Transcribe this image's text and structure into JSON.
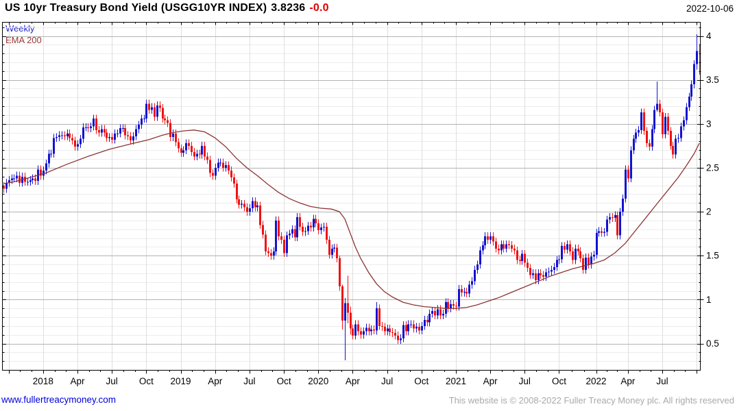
{
  "header": {
    "title": "US 10yr Treasury Bond Yield (USGG10YR INDEX)",
    "last_value": "3.8236",
    "change": "-0.0",
    "date": "2022-10-06"
  },
  "legend": {
    "series_label": "Weekly",
    "overlay_label": "EMA 200"
  },
  "footer": {
    "website": "www.fullertreacymoney.com",
    "copyright": "This website is © 2008-2022 Fuller Treacy Money plc. All rights reserved"
  },
  "colors": {
    "up_candle": "#1212d0",
    "down_candle": "#ee1212",
    "ema_line": "#8b3333",
    "grid_minor": "#ececec",
    "grid_major": "#b3b3b3",
    "grid_vertical": "#dedede",
    "axis": "#000000",
    "label": "#000000"
  },
  "chart_data": {
    "type": "candlestick",
    "frequency": "weekly",
    "title": "US 10yr Treasury Bond Yield (USGG10YR INDEX)",
    "symbol": "USGG10YR INDEX",
    "last": 3.8236,
    "change": -0.0,
    "as_of": "2022-10-06",
    "start_week": "2017-09-22",
    "end_week": "2022-10-06",
    "overlay": "EMA 200",
    "y_axis": {
      "min": 0.2,
      "max": 4.16,
      "minor_step": 0.1,
      "ticks": [
        0.5,
        1,
        1.5,
        2,
        2.5,
        3,
        3.5,
        4
      ]
    },
    "x_labels": [
      {
        "week": 2,
        "label": ""
      },
      {
        "week": 15,
        "label": "2018"
      },
      {
        "week": 28,
        "label": "Apr"
      },
      {
        "week": 41,
        "label": "Jul"
      },
      {
        "week": 54,
        "label": "Oct"
      },
      {
        "week": 67,
        "label": "2019"
      },
      {
        "week": 80,
        "label": "Apr"
      },
      {
        "week": 93,
        "label": "Jul"
      },
      {
        "week": 106,
        "label": "Oct"
      },
      {
        "week": 119,
        "label": "2020"
      },
      {
        "week": 132,
        "label": "Apr"
      },
      {
        "week": 145,
        "label": "Jul"
      },
      {
        "week": 158,
        "label": "Oct"
      },
      {
        "week": 171,
        "label": "2021"
      },
      {
        "week": 184,
        "label": "Apr"
      },
      {
        "week": 197,
        "label": "Jul"
      },
      {
        "week": 210,
        "label": "Oct"
      },
      {
        "week": 224,
        "label": "2022"
      },
      {
        "week": 236,
        "label": "Apr"
      },
      {
        "week": 249,
        "label": "Jul"
      },
      {
        "week": 262,
        "label": ""
      }
    ],
    "first_open": 2.29,
    "closes": [
      2.26,
      2.33,
      2.36,
      2.38,
      2.38,
      2.41,
      2.33,
      2.4,
      2.34,
      2.34,
      2.36,
      2.38,
      2.35,
      2.48,
      2.41,
      2.47,
      2.55,
      2.66,
      2.66,
      2.84,
      2.85,
      2.87,
      2.87,
      2.86,
      2.89,
      2.84,
      2.81,
      2.74,
      2.77,
      2.83,
      2.96,
      2.96,
      2.95,
      2.97,
      3.06,
      2.93,
      2.9,
      2.94,
      2.9,
      2.84,
      2.85,
      2.82,
      2.89,
      2.89,
      2.95,
      2.95,
      2.87,
      2.86,
      2.81,
      2.86,
      2.94,
      2.99,
      3.06,
      3.06,
      3.23,
      3.16,
      3.19,
      3.08,
      3.21,
      3.18,
      3.06,
      3.04,
      3.01,
      2.85,
      2.89,
      2.79,
      2.72,
      2.67,
      2.7,
      2.78,
      2.75,
      2.68,
      2.63,
      2.66,
      2.65,
      2.75,
      2.63,
      2.59,
      2.44,
      2.41,
      2.5,
      2.56,
      2.56,
      2.5,
      2.53,
      2.47,
      2.39,
      2.32,
      2.14,
      2.08,
      2.09,
      2.05,
      2.0,
      2.04,
      2.12,
      2.05,
      2.07,
      1.85,
      1.74,
      1.55,
      1.53,
      1.5,
      1.55,
      1.9,
      1.72,
      1.68,
      1.53,
      1.73,
      1.75,
      1.8,
      1.71,
      1.94,
      1.83,
      1.77,
      1.78,
      1.84,
      1.82,
      1.92,
      1.87,
      1.79,
      1.82,
      1.83,
      1.68,
      1.51,
      1.58,
      1.59,
      1.47,
      1.15,
      0.76,
      0.96,
      0.85,
      0.67,
      0.59,
      0.72,
      0.64,
      0.6,
      0.64,
      0.68,
      0.64,
      0.66,
      0.65,
      0.9,
      0.7,
      0.69,
      0.64,
      0.67,
      0.63,
      0.62,
      0.59,
      0.54,
      0.56,
      0.71,
      0.64,
      0.72,
      0.72,
      0.67,
      0.69,
      0.65,
      0.7,
      0.77,
      0.74,
      0.84,
      0.87,
      0.82,
      0.89,
      0.82,
      0.84,
      0.97,
      0.9,
      0.95,
      0.93,
      0.92,
      1.12,
      1.08,
      1.09,
      1.07,
      1.17,
      1.21,
      1.34,
      1.4,
      1.56,
      1.62,
      1.72,
      1.68,
      1.72,
      1.66,
      1.58,
      1.56,
      1.63,
      1.58,
      1.63,
      1.62,
      1.58,
      1.56,
      1.45,
      1.44,
      1.52,
      1.42,
      1.36,
      1.28,
      1.3,
      1.22,
      1.3,
      1.28,
      1.26,
      1.31,
      1.32,
      1.34,
      1.37,
      1.45,
      1.46,
      1.61,
      1.57,
      1.63,
      1.55,
      1.45,
      1.58,
      1.55,
      1.47,
      1.34,
      1.48,
      1.4,
      1.49,
      1.51,
      1.76,
      1.78,
      1.76,
      1.77,
      1.91,
      1.94,
      1.93,
      1.96,
      1.73,
      2.0,
      2.15,
      2.48,
      2.38,
      2.7,
      2.83,
      2.9,
      2.93,
      3.13,
      2.92,
      2.78,
      2.74,
      2.94,
      3.16,
      3.23,
      3.13,
      2.88,
      3.08,
      2.92,
      2.75,
      2.65,
      2.83,
      2.84,
      2.97,
      3.04,
      3.19,
      3.31,
      3.45,
      3.68,
      3.83,
      3.82
    ],
    "wick_pad": 0.045,
    "wick_overrides": {
      "127": [
        1.5,
        1.1
      ],
      "128": [
        1.17,
        0.66
      ],
      "129": [
        1.02,
        0.31
      ],
      "130": [
        1.27,
        0.73
      ],
      "131": [
        0.92,
        0.6
      ],
      "141": [
        0.97,
        0.6
      ],
      "247": [
        3.48,
        3.14
      ],
      "262": [
        4.02,
        3.62
      ],
      "263": [
        3.9,
        3.56
      ]
    },
    "ema_points": [
      [
        0,
        2.32
      ],
      [
        4,
        2.34
      ],
      [
        9,
        2.38
      ],
      [
        16,
        2.44
      ],
      [
        24,
        2.54
      ],
      [
        32,
        2.63
      ],
      [
        40,
        2.71
      ],
      [
        48,
        2.77
      ],
      [
        55,
        2.82
      ],
      [
        60,
        2.87
      ],
      [
        64,
        2.9
      ],
      [
        68,
        2.92
      ],
      [
        72,
        2.93
      ],
      [
        76,
        2.91
      ],
      [
        80,
        2.84
      ],
      [
        84,
        2.74
      ],
      [
        88,
        2.61
      ],
      [
        92,
        2.5
      ],
      [
        96,
        2.41
      ],
      [
        100,
        2.31
      ],
      [
        104,
        2.22
      ],
      [
        108,
        2.15
      ],
      [
        112,
        2.1
      ],
      [
        116,
        2.06
      ],
      [
        120,
        2.04
      ],
      [
        124,
        2.03
      ],
      [
        127,
        2.0
      ],
      [
        129,
        1.92
      ],
      [
        131,
        1.76
      ],
      [
        133,
        1.6
      ],
      [
        135,
        1.47
      ],
      [
        138,
        1.31
      ],
      [
        141,
        1.18
      ],
      [
        144,
        1.09
      ],
      [
        147,
        1.03
      ],
      [
        151,
        0.97
      ],
      [
        155,
        0.94
      ],
      [
        159,
        0.92
      ],
      [
        163,
        0.91
      ],
      [
        167,
        0.9
      ],
      [
        171,
        0.9
      ],
      [
        175,
        0.91
      ],
      [
        179,
        0.94
      ],
      [
        183,
        0.98
      ],
      [
        187,
        1.02
      ],
      [
        191,
        1.07
      ],
      [
        195,
        1.12
      ],
      [
        199,
        1.17
      ],
      [
        203,
        1.22
      ],
      [
        207,
        1.27
      ],
      [
        211,
        1.31
      ],
      [
        215,
        1.35
      ],
      [
        219,
        1.38
      ],
      [
        223,
        1.41
      ],
      [
        227,
        1.45
      ],
      [
        231,
        1.53
      ],
      [
        235,
        1.64
      ],
      [
        239,
        1.79
      ],
      [
        243,
        1.94
      ],
      [
        247,
        2.09
      ],
      [
        251,
        2.24
      ],
      [
        255,
        2.39
      ],
      [
        258,
        2.52
      ],
      [
        261,
        2.66
      ],
      [
        263,
        2.78
      ]
    ]
  }
}
